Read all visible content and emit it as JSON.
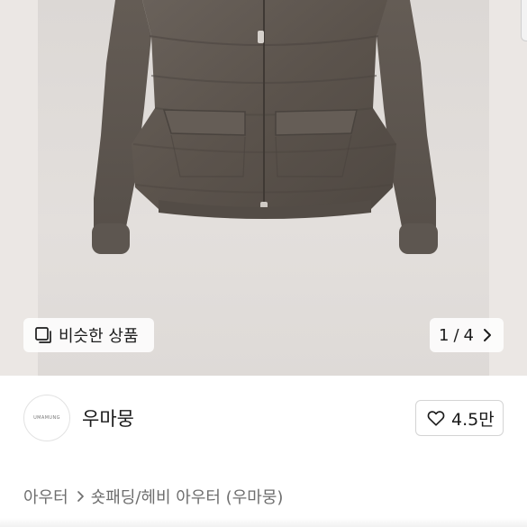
{
  "gallery": {
    "similar_label": "비슷한 상품",
    "current": "1",
    "separator": "/",
    "total": "4"
  },
  "seller": {
    "avatar_text": "UMAMUNG",
    "name": "우마뭉",
    "likes": "4.5만"
  },
  "breadcrumb": {
    "level1": "아우터",
    "level2": "숏패딩/헤비 아우터 (우마뭉)"
  },
  "colors": {
    "jacket": "#5b534c",
    "photo_background": "#dedad7",
    "chip_background": "#ffffff"
  },
  "icons": {
    "similar": "similar-items-icon",
    "next": "chevron-right-icon",
    "like": "heart-outline-icon",
    "breadcrumb_separator": "chevron-right-icon"
  }
}
